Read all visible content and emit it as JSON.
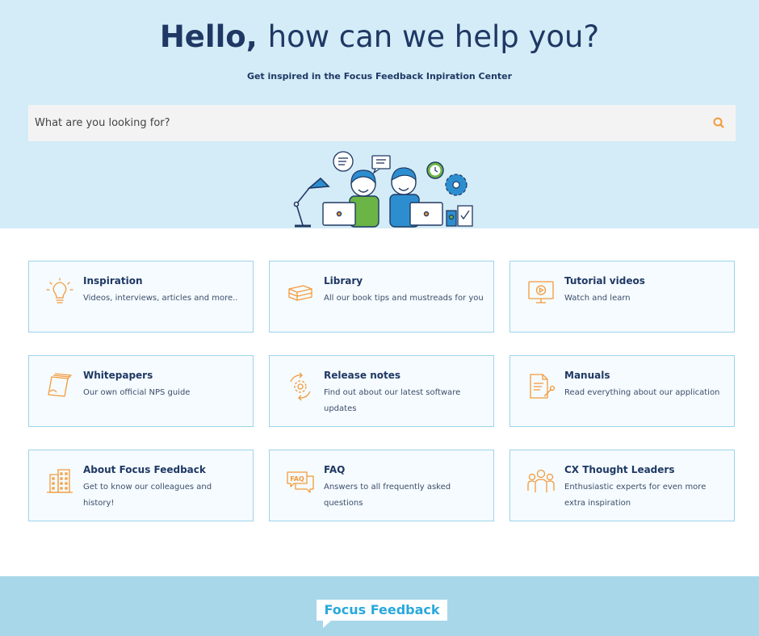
{
  "hero": {
    "title_bold": "Hello",
    "title_comma": ",",
    "title_rest": "how can we help you?",
    "subtitle": "Get inspired in the Focus Feedback Inpiration Center"
  },
  "search": {
    "placeholder": "What are you looking for?",
    "icon": "search-icon"
  },
  "colors": {
    "hero_bg": "#d3ecf7",
    "accent_orange": "#f39a3c",
    "card_border": "#9dd4ea",
    "footer_bg": "#a8d7ea",
    "brand_blue": "#29a8dc",
    "navy": "#1f3864"
  },
  "cards": [
    {
      "title": "Inspiration",
      "desc": "Videos, interviews, articles and more..",
      "icon": "lightbulb-icon"
    },
    {
      "title": "Library",
      "desc": "All our book tips and mustreads for you",
      "icon": "books-icon"
    },
    {
      "title": "Tutorial videos",
      "desc": "Watch and learn",
      "icon": "video-screen-icon"
    },
    {
      "title": "Whitepapers",
      "desc": "Our own official NPS guide",
      "icon": "papers-icon"
    },
    {
      "title": "Release notes",
      "desc": "Find out about our latest software updates",
      "icon": "gear-refresh-icon"
    },
    {
      "title": "Manuals",
      "desc": "Read everything about our application",
      "icon": "document-wrench-icon"
    },
    {
      "title": "About Focus Feedback",
      "desc": "Get to know our colleagues and history!",
      "icon": "building-icon"
    },
    {
      "title": "FAQ",
      "desc": "Answers to all frequently asked questions",
      "icon": "faq-bubble-icon"
    },
    {
      "title": "CX Thought Leaders",
      "desc": "Enthusiastic experts for even more extra inspiration",
      "icon": "people-icon"
    }
  ],
  "footer": {
    "logo_text": "Focus Feedback"
  }
}
